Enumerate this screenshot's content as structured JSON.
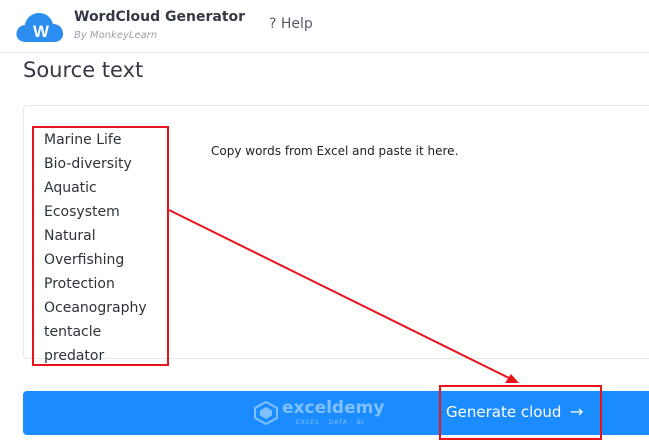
{
  "header": {
    "app_name": "WordCloud Generator",
    "byline": "By MonkeyLearn",
    "logo_letter": "W",
    "help_label": "? Help"
  },
  "source": {
    "title": "Source text",
    "placeholder": "Copy words from Excel and paste it here.",
    "words": [
      "Marine Life",
      "Bio-diversity",
      "Aquatic",
      "Ecosystem",
      "Natural",
      "Overfishing",
      "Protection",
      "Oceanography",
      "tentacle",
      "predator"
    ]
  },
  "action": {
    "generate_label": "Generate cloud",
    "arrow_glyph": "→"
  },
  "watermark": {
    "name": "exceldemy",
    "tagline": "EXCEL · DATA · BI"
  },
  "colors": {
    "primary": "#1a8cff",
    "annotation_red": "#e8141b"
  },
  "icons": {
    "logo": "cloud-icon",
    "generate": "arrow-right-icon",
    "watermark": "exceldemy-logo-icon"
  }
}
